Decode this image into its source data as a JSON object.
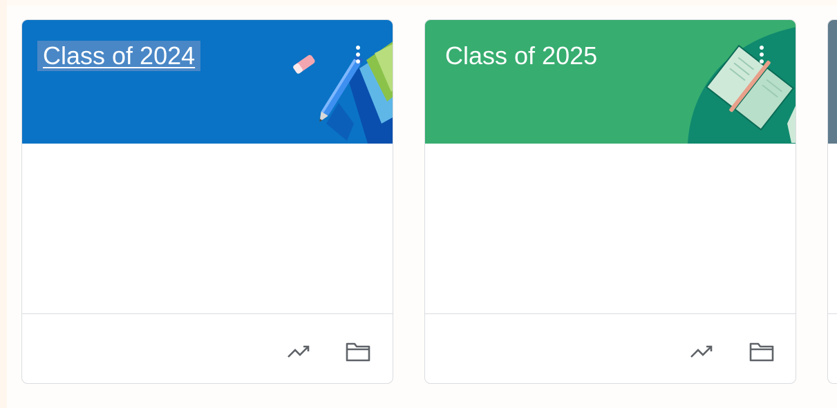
{
  "classes": [
    {
      "title": "Class of 2024",
      "header_color": "#0a73c5",
      "more_icon": "more-vert-icon",
      "footer_icons": [
        "trending-up-icon",
        "folder-icon"
      ]
    },
    {
      "title": "Class of 2025",
      "header_color": "#37ad70",
      "more_icon": "more-vert-icon",
      "footer_icons": [
        "trending-up-icon",
        "folder-icon"
      ]
    },
    {
      "title": "",
      "header_color": "#5f7b8c"
    }
  ],
  "colors": {
    "card_border": "#dadce0",
    "icon_gray": "#5f6368",
    "title_highlight": "#4a87c6"
  }
}
